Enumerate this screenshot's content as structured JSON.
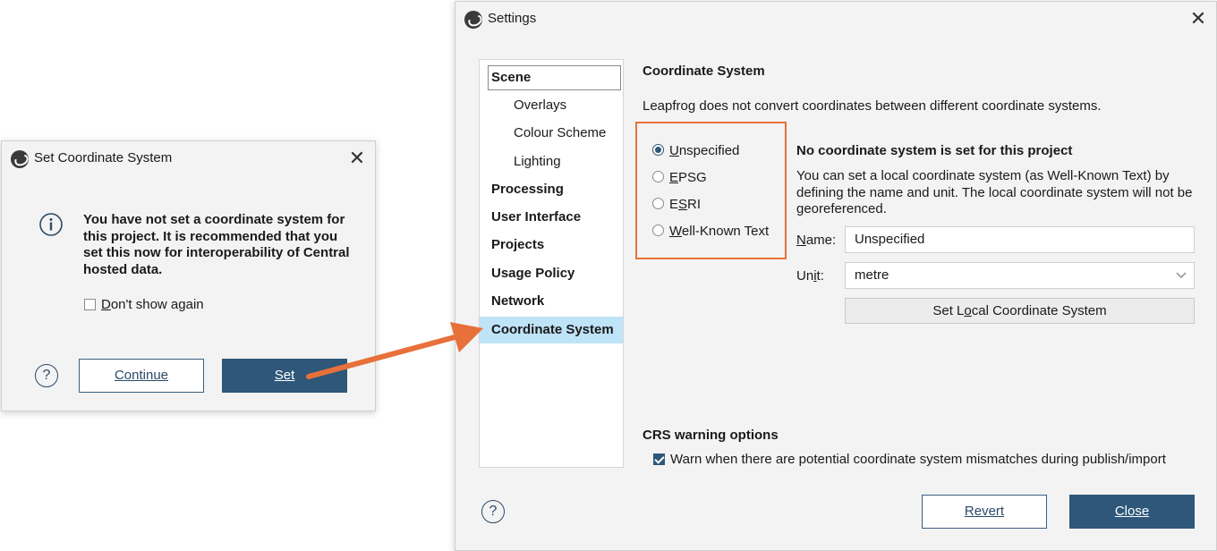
{
  "set_dialog": {
    "title": "Set Coordinate System",
    "message_line1": "You have not set a coordinate system for",
    "message_line2": "this project. It is recommended that you",
    "message_line3": "set this now for interoperability of Central",
    "message_line4": "hosted data.",
    "dont_show_again": "Don't show again",
    "dont_show_checked": false,
    "continue_label": "Continue",
    "set_label": "Set",
    "help_glyph": "?",
    "close_glyph": "✕"
  },
  "settings": {
    "title": "Settings",
    "close_glyph": "✕",
    "nav": [
      {
        "label": "Scene"
      },
      {
        "label": "Overlays"
      },
      {
        "label": "Colour Scheme"
      },
      {
        "label": "Lighting"
      },
      {
        "label": "Processing"
      },
      {
        "label": "User Interface"
      },
      {
        "label": "Projects"
      },
      {
        "label": "Usage Policy"
      },
      {
        "label": "Network"
      },
      {
        "label": "Coordinate System"
      }
    ],
    "selected_nav": "Coordinate System",
    "heading": "Coordinate System",
    "description": "Leapfrog does not convert coordinates between different coordinate systems.",
    "options": [
      {
        "label": "Unspecified",
        "checked": true
      },
      {
        "label": "EPSG",
        "checked": false
      },
      {
        "label": "ESRI",
        "checked": false
      },
      {
        "label": "Well-Known Text",
        "checked": false
      }
    ],
    "status_heading": "No coordinate system is set for this project",
    "info_line1": "You can set a local coordinate system (as Well-Known Text) by",
    "info_line2": "defining the name and unit. The local coordinate system will not be",
    "info_line3": "georeferenced.",
    "name_label": "Name:",
    "name_value": "Unspecified",
    "unit_label": "Unit:",
    "unit_value": "metre",
    "set_local_button": "Set Local Coordinate System",
    "crs_heading": "CRS warning options",
    "warn_label": "Warn when there are potential coordinate system mismatches during publish/import",
    "warn_checked": true,
    "revert_label": "Revert",
    "close_label": "Close",
    "help_glyph": "?"
  },
  "colors": {
    "accent": "#2e5779",
    "highlight_box": "#e8703a",
    "nav_selected": "#bfe3f7"
  }
}
